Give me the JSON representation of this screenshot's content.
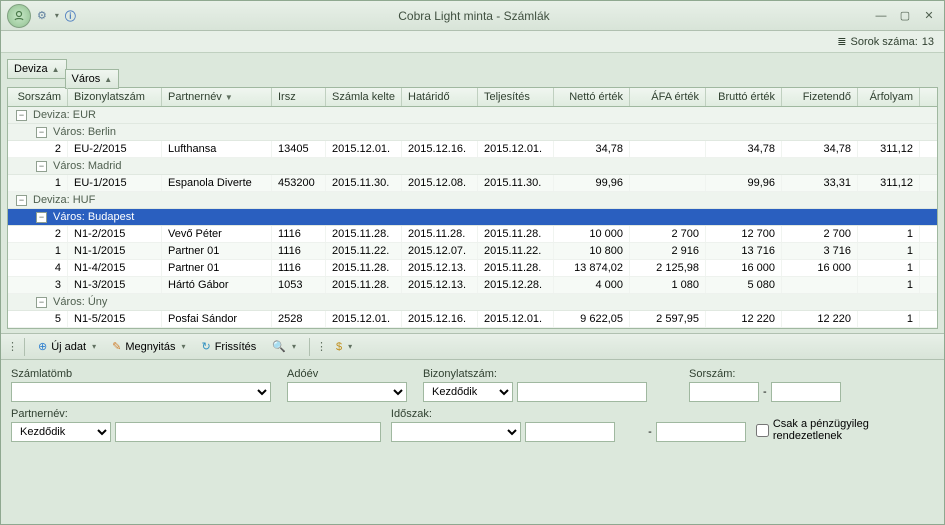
{
  "window": {
    "title": "Cobra Light minta - Számlák"
  },
  "status": {
    "row_count_label": "Sorok száma:",
    "row_count": "13"
  },
  "group_chips": {
    "c1": "Deviza",
    "c2": "Város"
  },
  "columns": {
    "sorszam": "Sorszám",
    "bizonylat": "Bizonylatszám",
    "partner": "Partnernév",
    "irsz": "Irsz",
    "kelte": "Számla kelte",
    "hatarido": "Határidő",
    "teljesites": "Teljesítés",
    "netto": "Nettó érték",
    "afa": "ÁFA érték",
    "brutto": "Bruttó érték",
    "fizetendo": "Fizetendő",
    "arfolyam": "Árfolyam"
  },
  "groups": {
    "eur": "Deviza: EUR",
    "huf": "Deviza: HUF",
    "berlin": "Város: Berlin",
    "madrid": "Város: Madrid",
    "budapest": "Város: Budapest",
    "uny": "Város: Úny"
  },
  "rows": {
    "r1": {
      "sor": "2",
      "biz": "EU-2/2015",
      "part": "Lufthansa",
      "irsz": "13405",
      "kelte": "2015.12.01.",
      "hat": "2015.12.16.",
      "telj": "2015.12.01.",
      "net": "34,78",
      "afa": "",
      "bru": "34,78",
      "fiz": "34,78",
      "arf": "311,12"
    },
    "r2": {
      "sor": "1",
      "biz": "EU-1/2015",
      "part": "Espanola Diverte",
      "irsz": "453200",
      "kelte": "2015.11.30.",
      "hat": "2015.12.08.",
      "telj": "2015.11.30.",
      "net": "99,96",
      "afa": "",
      "bru": "99,96",
      "fiz": "33,31",
      "arf": "311,12"
    },
    "r3": {
      "sor": "2",
      "biz": "N1-2/2015",
      "part": "Vevő Péter",
      "irsz": "1116",
      "kelte": "2015.11.28.",
      "hat": "2015.11.28.",
      "telj": "2015.11.28.",
      "net": "10 000",
      "afa": "2 700",
      "bru": "12 700",
      "fiz": "2 700",
      "arf": "1"
    },
    "r4": {
      "sor": "1",
      "biz": "N1-1/2015",
      "part": "Partner 01",
      "irsz": "1116",
      "kelte": "2015.11.22.",
      "hat": "2015.12.07.",
      "telj": "2015.11.22.",
      "net": "10 800",
      "afa": "2 916",
      "bru": "13 716",
      "fiz": "3 716",
      "arf": "1"
    },
    "r5": {
      "sor": "4",
      "biz": "N1-4/2015",
      "part": "Partner 01",
      "irsz": "1116",
      "kelte": "2015.11.28.",
      "hat": "2015.12.13.",
      "telj": "2015.11.28.",
      "net": "13 874,02",
      "afa": "2 125,98",
      "bru": "16 000",
      "fiz": "16 000",
      "arf": "1"
    },
    "r6": {
      "sor": "3",
      "biz": "N1-3/2015",
      "part": "Hártó Gábor",
      "irsz": "1053",
      "kelte": "2015.11.28.",
      "hat": "2015.12.13.",
      "telj": "2015.12.28.",
      "net": "4 000",
      "afa": "1 080",
      "bru": "5 080",
      "fiz": "",
      "arf": "1"
    },
    "r7": {
      "sor": "5",
      "biz": "N1-5/2015",
      "part": "Posfai Sándor",
      "irsz": "2528",
      "kelte": "2015.12.01.",
      "hat": "2015.12.16.",
      "telj": "2015.12.01.",
      "net": "9 622,05",
      "afa": "2 597,95",
      "bru": "12 220",
      "fiz": "12 220",
      "arf": "1"
    }
  },
  "toolbar": {
    "uj": "Új adat",
    "meg": "Megnyitás",
    "fris": "Frissítés"
  },
  "filter": {
    "szamlatomb": "Számlatömb",
    "adoev": "Adóév",
    "bizonylat": "Bizonylatszám:",
    "sorszam": "Sorszám:",
    "partnernev": "Partnernév:",
    "idoszak": "Időszak:",
    "kezdodik": "Kezdődik",
    "dash": "-",
    "csak": "Csak a pénzügyileg rendezetlenek"
  }
}
